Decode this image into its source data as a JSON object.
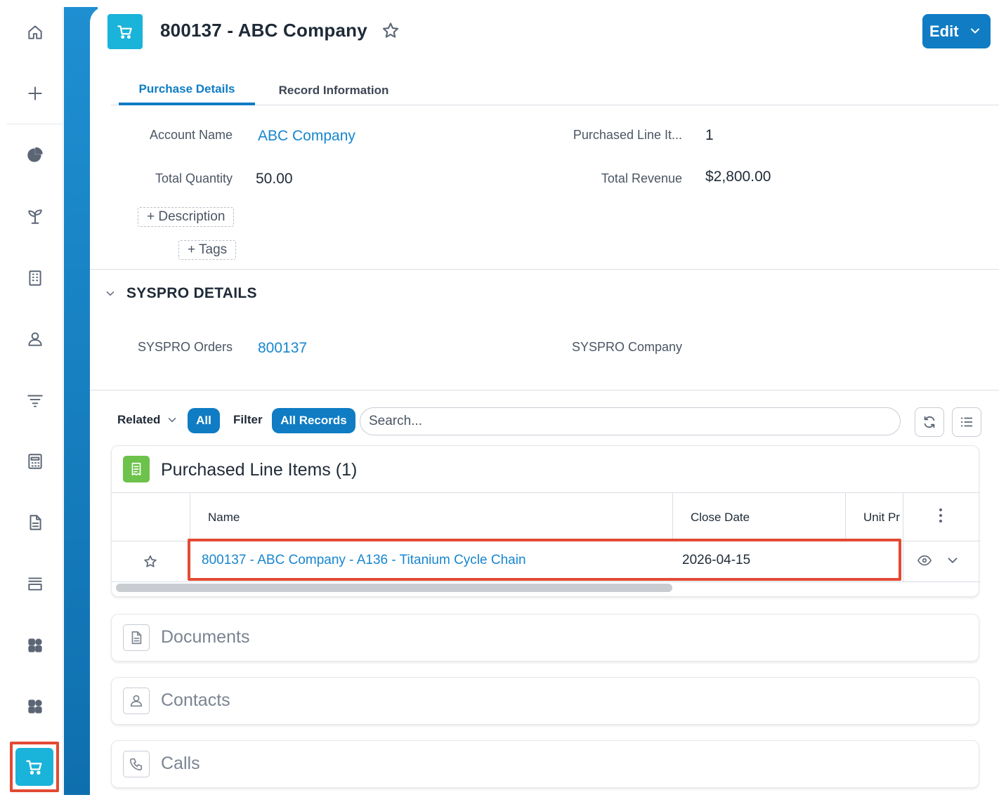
{
  "record": {
    "title": "800137 - ABC Company",
    "edit_label": "Edit"
  },
  "tabs": [
    {
      "label": "Purchase Details"
    },
    {
      "label": "Record Information"
    }
  ],
  "fields": {
    "account_name_label": "Account Name",
    "account_name_value": "ABC Company",
    "purchased_line_items_label": "Purchased Line It...",
    "purchased_line_items_value": "1",
    "total_quantity_label": "Total Quantity",
    "total_quantity_value": "50.00",
    "total_revenue_label": "Total Revenue",
    "total_revenue_value": "$2,800.00",
    "description_chip": "+ Description",
    "tags_chip": "+ Tags"
  },
  "syspro": {
    "section_title": "SYSPRO DETAILS",
    "orders_label": "SYSPRO Orders",
    "orders_value": "800137",
    "company_label": "SYSPRO Company"
  },
  "related": {
    "related_label": "Related",
    "all_label": "All",
    "filter_label": "Filter",
    "all_records_label": "All Records",
    "search_placeholder": "Search..."
  },
  "purchased_line_items": {
    "title": "Purchased Line Items (1)",
    "columns": [
      "Name",
      "Close Date",
      "Unit Pr"
    ],
    "rows": [
      {
        "name": "800137 - ABC Company - A136 - Titanium Cycle Chain",
        "close_date": "2026-04-15"
      }
    ]
  },
  "collapsed_sections": [
    {
      "title": "Documents",
      "icon": "document-icon"
    },
    {
      "title": "Contacts",
      "icon": "contact-icon"
    },
    {
      "title": "Calls",
      "icon": "phone-icon"
    }
  ],
  "colors": {
    "accent": "#0f7cc4",
    "record_icon": "#1ab3d9",
    "highlight": "#e24a33",
    "line_items_icon": "#6cc24a"
  }
}
